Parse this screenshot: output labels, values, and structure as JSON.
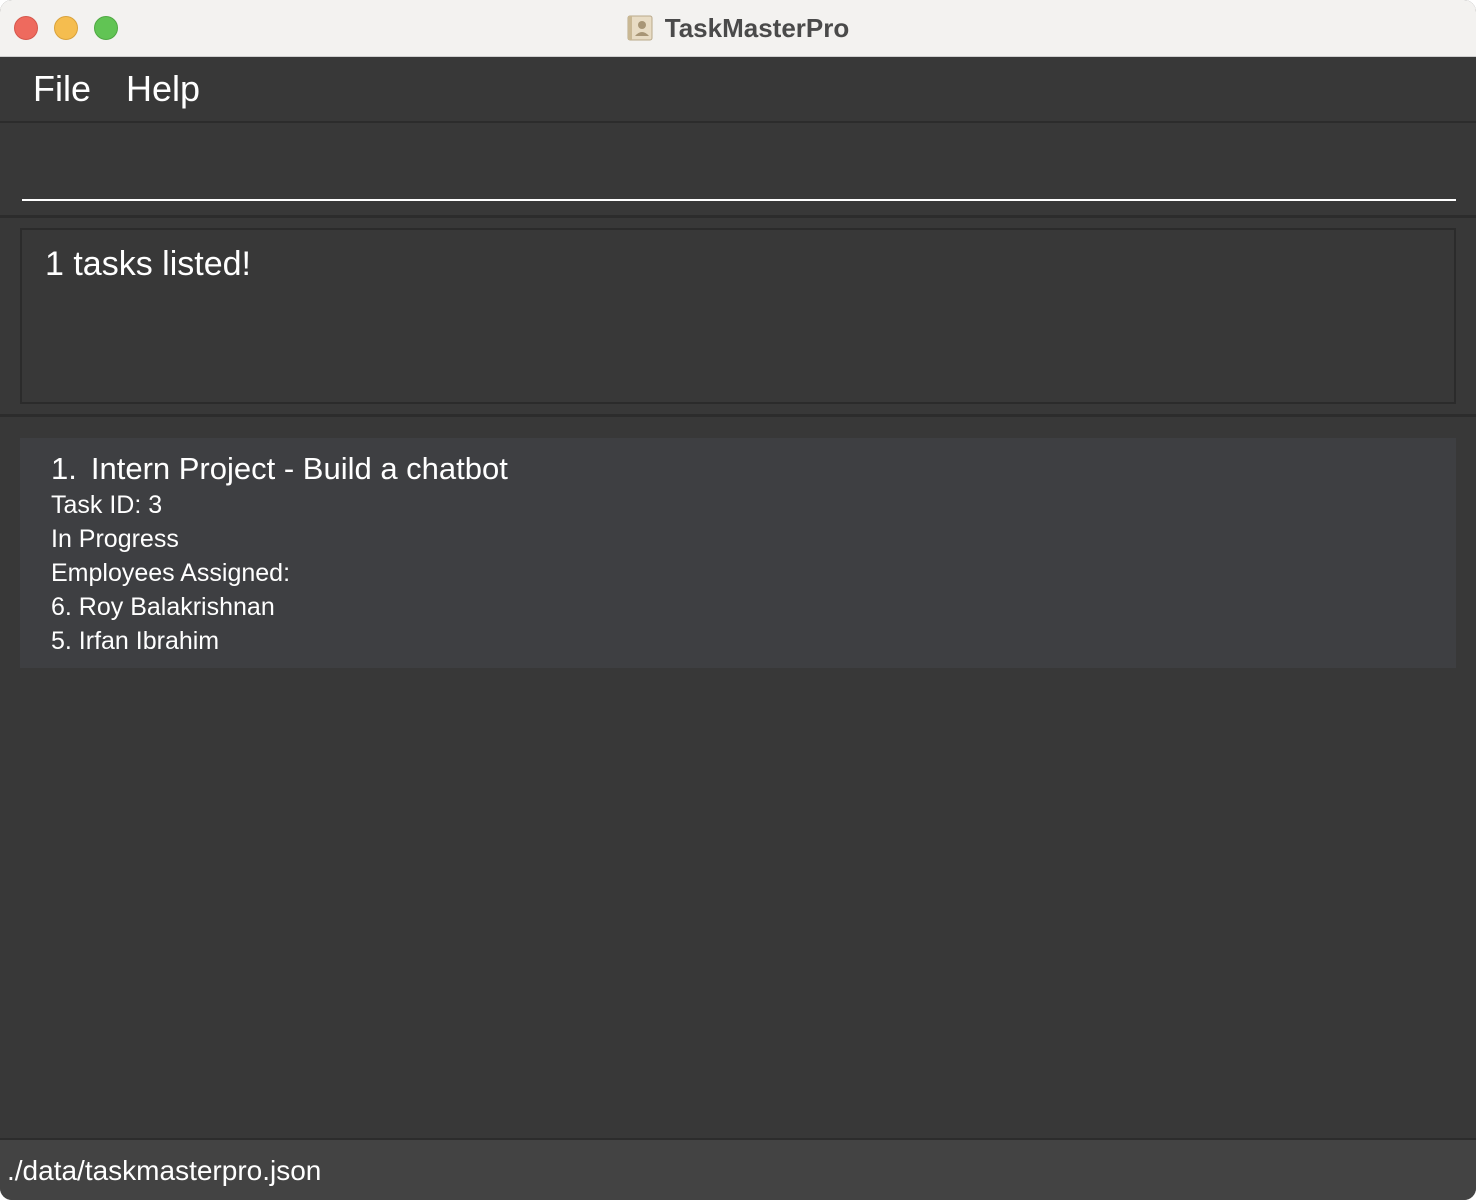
{
  "window": {
    "title": "TaskMasterPro"
  },
  "menubar": {
    "file_label": "File",
    "help_label": "Help"
  },
  "command": {
    "value": "",
    "placeholder": ""
  },
  "result": {
    "message": "1 tasks listed!"
  },
  "tasks": [
    {
      "index": "1.",
      "name": "Intern Project - Build a chatbot",
      "task_id": "Task ID: 3",
      "status": "In Progress",
      "employees_header": "Employees Assigned:",
      "employees": [
        "6. Roy Balakrishnan",
        "5. Irfan Ibrahim"
      ]
    }
  ],
  "statusbar": {
    "path": "./data/taskmasterpro.json"
  },
  "icons": {
    "app": "contacts-app-icon"
  },
  "colors": {
    "background": "#383838",
    "card": "#3e3f42",
    "statusbar": "#434343",
    "text": "#ffffff"
  }
}
